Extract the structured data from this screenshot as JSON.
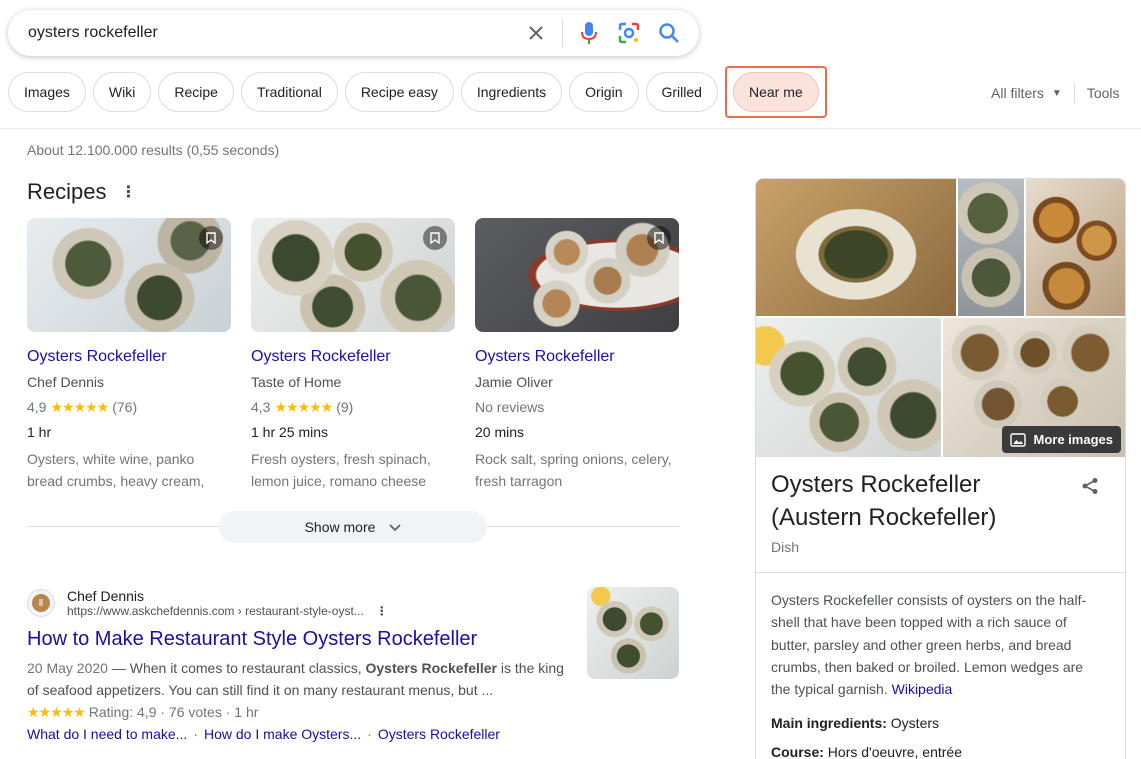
{
  "search": {
    "query": "oysters rockefeller"
  },
  "chips": [
    "Images",
    "Wiki",
    "Recipe",
    "Traditional",
    "Recipe easy",
    "Ingredients",
    "Origin",
    "Grilled"
  ],
  "highlighted_chip": "Near me",
  "filters": {
    "all_filters": "All filters",
    "tools": "Tools"
  },
  "results_count": "About 12.100.000 results (0,55 seconds)",
  "recipes": {
    "title": "Recipes",
    "items": [
      {
        "name": "Oysters Rockefeller",
        "source": "Chef Dennis",
        "rating": "4,9",
        "stars": "★★★★★",
        "reviews": "(76)",
        "time": "1 hr",
        "ingredients": "Oysters, white wine, panko bread crumbs, heavy cream,"
      },
      {
        "name": "Oysters Rockefeller",
        "source": "Taste of Home",
        "rating": "4,3",
        "stars": "★★★★★",
        "reviews": "(9)",
        "time": "1 hr 25 mins",
        "ingredients": "Fresh oysters, fresh spinach, lemon juice, romano cheese"
      },
      {
        "name": "Oysters Rockefeller",
        "source": "Jamie Oliver",
        "no_reviews": "No reviews",
        "time": "20 mins",
        "ingredients": "Rock salt, spring onions, celery, fresh tarragon"
      }
    ],
    "show_more": "Show more"
  },
  "web_result": {
    "site_name": "Chef Dennis",
    "url": "https://www.askchefdennis.com › restaurant-style-oyst...",
    "title": "How to Make Restaurant Style Oysters Rockefeller",
    "date": "20 May 2020",
    "snippet_pre": " — When it comes to restaurant classics, ",
    "snippet_bold": "Oysters Rockefeller",
    "snippet_post": " is the king of seafood appetizers. You can still find it on many restaurant menus, but ...",
    "stars": "★★★★★",
    "rating_text": "Rating: 4,9 · 76 votes · 1 hr",
    "links": [
      "What do I need to make...",
      "How do I make Oysters...",
      "Oysters Rockefeller"
    ]
  },
  "knowledge_panel": {
    "more_images": "More images",
    "title": "Oysters Rockefeller (Austern Rockefeller)",
    "subtitle": "Dish",
    "description": "Oysters Rockefeller consists of oysters on the half-shell that have been topped with a rich sauce of butter, parsley and other green herbs, and bread crumbs, then baked or broiled. Lemon wedges are the typical garnish.",
    "wiki_link": "Wikipedia",
    "facts": [
      {
        "label": "Main ingredients:",
        "value": "Oysters"
      },
      {
        "label": "Course:",
        "value": "Hors d'oeuvre, entrée"
      }
    ]
  },
  "colors": {
    "link": "#1a0dab",
    "star": "#fbbc04",
    "highlight_border": "#ef6b4a",
    "highlight_fill": "#fbe3dc"
  }
}
